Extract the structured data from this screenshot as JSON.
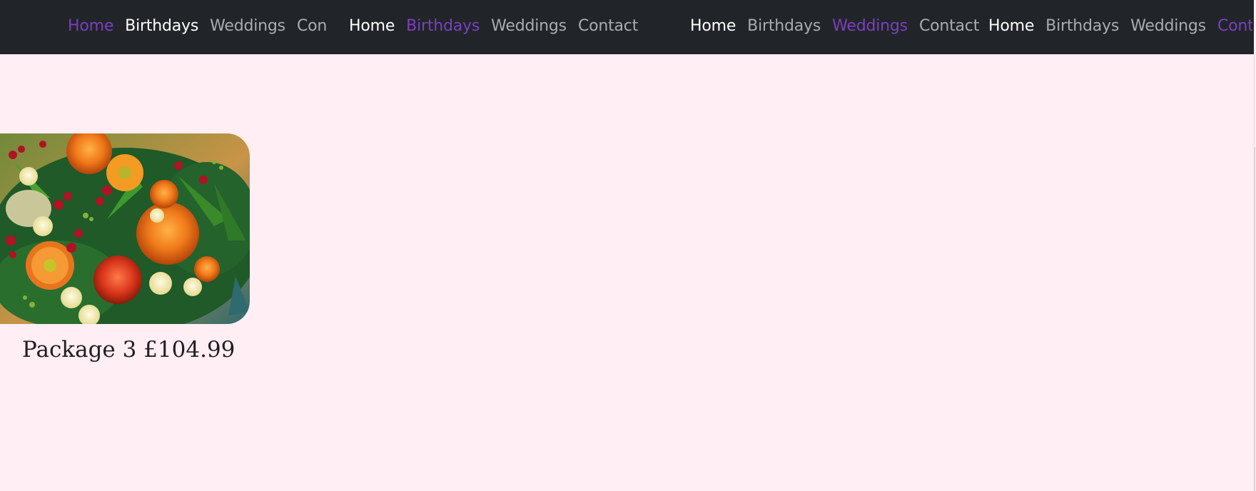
{
  "nav_groups": [
    {
      "links": [
        {
          "label": "Home",
          "state": "current"
        },
        {
          "label": "Birthdays",
          "state": "active"
        },
        {
          "label": "Weddings",
          "state": "normal"
        },
        {
          "label": "Contact",
          "state": "normal"
        }
      ]
    },
    {
      "links": [
        {
          "label": "Home",
          "state": "active"
        },
        {
          "label": "Birthdays",
          "state": "current"
        },
        {
          "label": "Weddings",
          "state": "normal"
        },
        {
          "label": "Contact",
          "state": "normal"
        }
      ]
    },
    {
      "links": [
        {
          "label": "Home",
          "state": "active"
        },
        {
          "label": "Birthdays",
          "state": "normal"
        },
        {
          "label": "Weddings",
          "state": "current"
        },
        {
          "label": "Contact",
          "state": "normal"
        }
      ]
    },
    {
      "links": [
        {
          "label": "Home",
          "state": "active"
        },
        {
          "label": "Birthdays",
          "state": "normal"
        },
        {
          "label": "Weddings",
          "state": "normal"
        },
        {
          "label": "Contact",
          "state": "current"
        }
      ]
    }
  ],
  "card": {
    "caption": "Package 3 £104.99"
  },
  "colors": {
    "navbar_bg": "#212529",
    "page_bg": "#ffeef4",
    "nav_current": "#7b3fbf",
    "nav_active": "#ffffff",
    "nav_normal": "#a9acb0"
  }
}
